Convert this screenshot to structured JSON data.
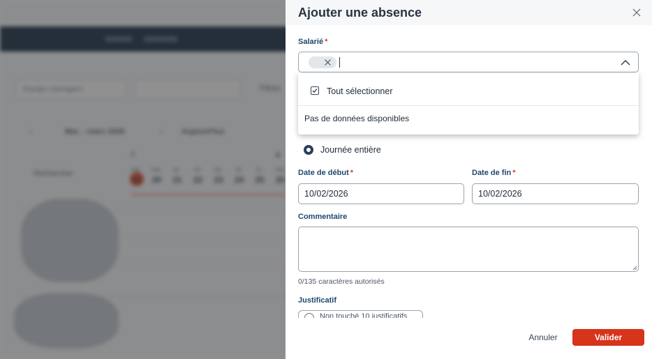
{
  "background": {
    "filter_1": "Equipe managers",
    "nav_label": "Mar. - mars 2026",
    "nav_right": "Aujourd'hui",
    "filter_3": "Filtres",
    "search_placeholder": "Rechercher",
    "days": [
      {
        "name": "ma.",
        "num": "19"
      },
      {
        "name": "me.",
        "num": "20"
      },
      {
        "name": "je.",
        "num": "21"
      },
      {
        "name": "ve.",
        "num": "22"
      },
      {
        "name": "sa.",
        "num": "23"
      },
      {
        "name": "di.",
        "num": "24"
      },
      {
        "name": "lu.",
        "num": "25"
      },
      {
        "name": "ma.",
        "num": "26"
      }
    ]
  },
  "drawer": {
    "title": "Ajouter une absence",
    "employee_label": "Salarié",
    "required_mark": "*",
    "dropdown": {
      "select_all": "Tout sélectionner",
      "empty": "Pas de données disponibles"
    },
    "full_day_label": "Journée entière",
    "start_label": "Date de début",
    "start_value": "10/02/2026",
    "end_label": "Date de fin",
    "end_value": "10/02/2026",
    "comment_label": "Commentaire",
    "comment_value": "",
    "comment_helper": "0/135 caractères autorisés",
    "justif_label": "Justificatif",
    "justif_option": "Non touché 10 justificatifs",
    "cancel": "Annuler",
    "submit": "Valider"
  },
  "colors": {
    "accent": "#d8331b",
    "label": "#1f4770",
    "required": "#d8402a"
  }
}
